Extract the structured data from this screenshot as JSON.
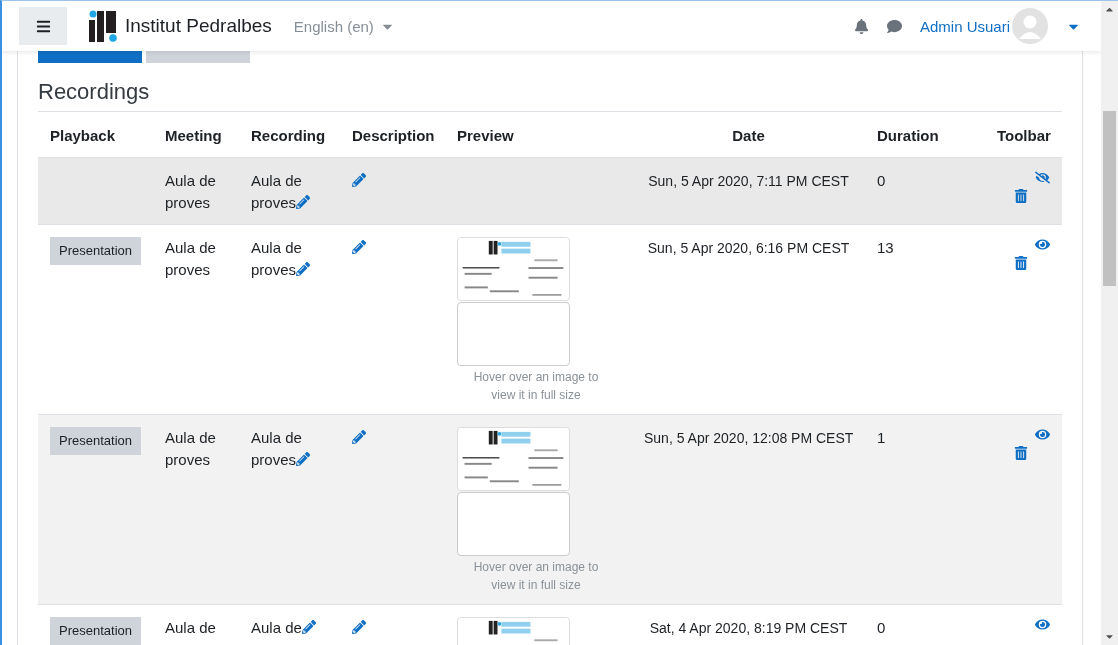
{
  "navbar": {
    "site_name": "Institut Pedralbes",
    "language": "English (en)",
    "user_name": "Admin Usuari"
  },
  "top_buttons": [
    {
      "selected": true
    },
    {
      "selected": false
    }
  ],
  "section_title": "Recordings",
  "table": {
    "columns": [
      "Playback",
      "Meeting",
      "Recording",
      "Description",
      "Preview",
      "Date",
      "Duration",
      "Toolbar"
    ],
    "rows": [
      {
        "meeting": "Aula de proves",
        "recording": "Aula de proves",
        "date": "Sun, 5 Apr 2020, 7:11 PM CEST",
        "duration": "0",
        "published": false,
        "toolbar": [
          {
            "kind": "visibility"
          },
          {
            "kind": "delete"
          }
        ]
      },
      {
        "playback": "Presentation",
        "meeting": "Aula de proves",
        "recording": "Aula de proves",
        "preview": {
          "thumbnails": [
            {
              "kind": "picture"
            },
            {
              "kind": "blank"
            }
          ],
          "hint": "Hover over an image to view it in full size"
        },
        "date": "Sun, 5 Apr 2020, 6:16 PM CEST",
        "duration": "13",
        "published": true,
        "toolbar": [
          {
            "kind": "visibility"
          },
          {
            "kind": "delete"
          }
        ]
      },
      {
        "playback": "Presentation",
        "meeting": "Aula de proves",
        "recording": "Aula de proves",
        "preview": {
          "thumbnails": [
            {
              "kind": "picture"
            },
            {
              "kind": "blank"
            }
          ],
          "hint": "Hover over an image to view it in full size"
        },
        "date": "Sun, 5 Apr 2020, 12:08 PM CEST",
        "duration": "1",
        "published": true,
        "toolbar": [
          {
            "kind": "visibility"
          },
          {
            "kind": "delete"
          }
        ]
      },
      {
        "playback": "Presentation",
        "meeting": "Aula de",
        "recording": "Aula de",
        "preview": {
          "thumbnails": [
            {
              "kind": "picture"
            }
          ]
        },
        "date": "Sat, 4 Apr 2020, 8:19 PM CEST",
        "duration": "0",
        "published": true,
        "toolbar": [
          {
            "kind": "visibility"
          }
        ]
      }
    ]
  }
}
